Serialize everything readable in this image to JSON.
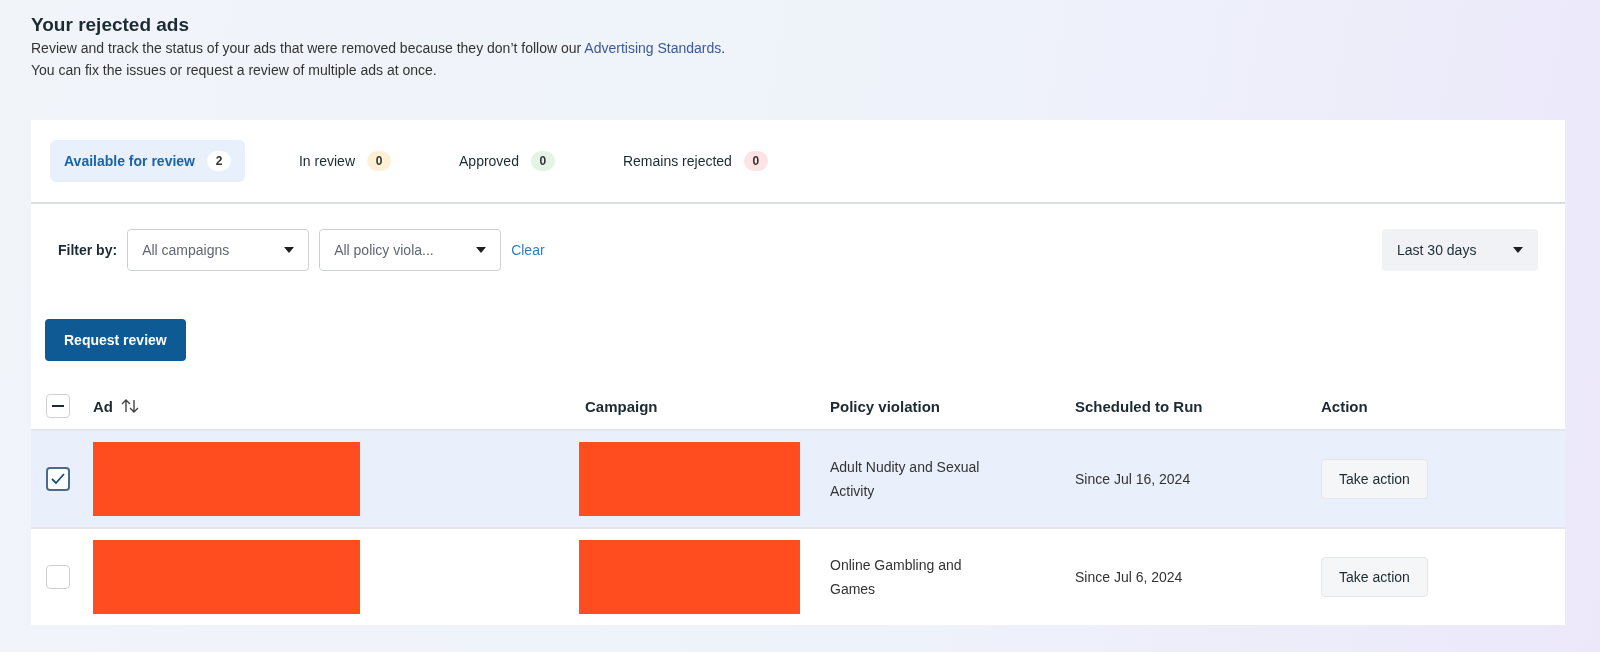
{
  "header": {
    "title": "Your rejected ads",
    "description_before": "Review and track the status of your ads that were removed because they don’t follow our",
    "link": "Advertising Standards",
    "description_after": ".",
    "description_line2": "You can fix the issues or request a review of multiple ads at once."
  },
  "tabs": [
    {
      "label": "Available for review",
      "count": "2",
      "selected": true,
      "color": "#ffffff"
    },
    {
      "label": "In review",
      "count": "0",
      "selected": false,
      "color": "#fdf0d5"
    },
    {
      "label": "Approved",
      "count": "0",
      "selected": false,
      "color": "#e3f4e6"
    },
    {
      "label": "Remains rejected",
      "count": "0",
      "selected": false,
      "color": "#fde3e3"
    }
  ],
  "filters": {
    "label": "Filter by:",
    "dropdowns": [
      "All campaigns",
      "All policy viola..."
    ],
    "clear": "Clear",
    "date_range": "Last 30 days"
  },
  "request_button": "Request review",
  "table": {
    "select_all_indeterminate": true,
    "columns": [
      "Ad",
      "Campaign",
      "Policy violation",
      "Scheduled to Run",
      "Action"
    ],
    "rows": [
      {
        "selected": true,
        "policy": "Adult Nudity and Sexual Activity",
        "scheduled": "Since Jul 16, 2024",
        "action": "Take action"
      },
      {
        "selected": false,
        "policy": "Online Gambling and Games",
        "scheduled": "Since Jul 6, 2024",
        "action": "Take action"
      }
    ]
  }
}
